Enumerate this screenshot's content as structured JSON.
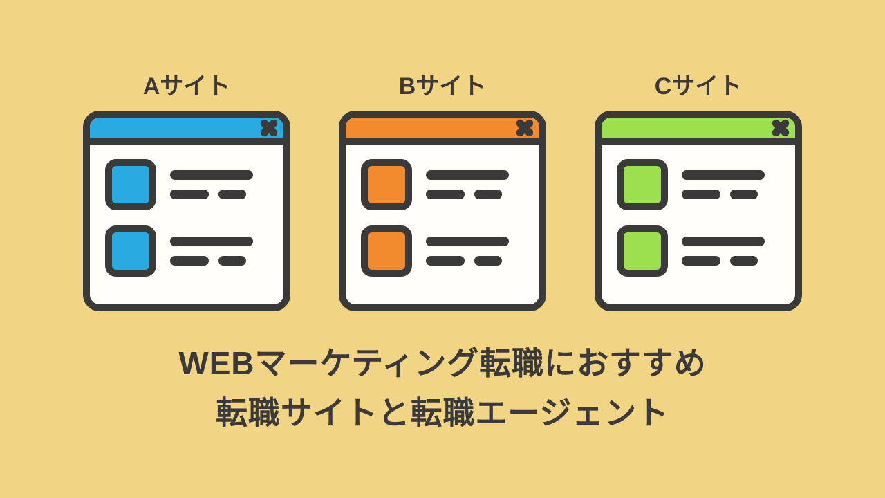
{
  "sites": [
    {
      "label": "Aサイト",
      "color": "#29abe2"
    },
    {
      "label": "Bサイト",
      "color": "#f28a2e"
    },
    {
      "label": "Cサイト",
      "color": "#9de04f"
    }
  ],
  "caption_line1": "WEBマーケティング転職におすすめ",
  "caption_line2": "転職サイトと転職エージェント"
}
